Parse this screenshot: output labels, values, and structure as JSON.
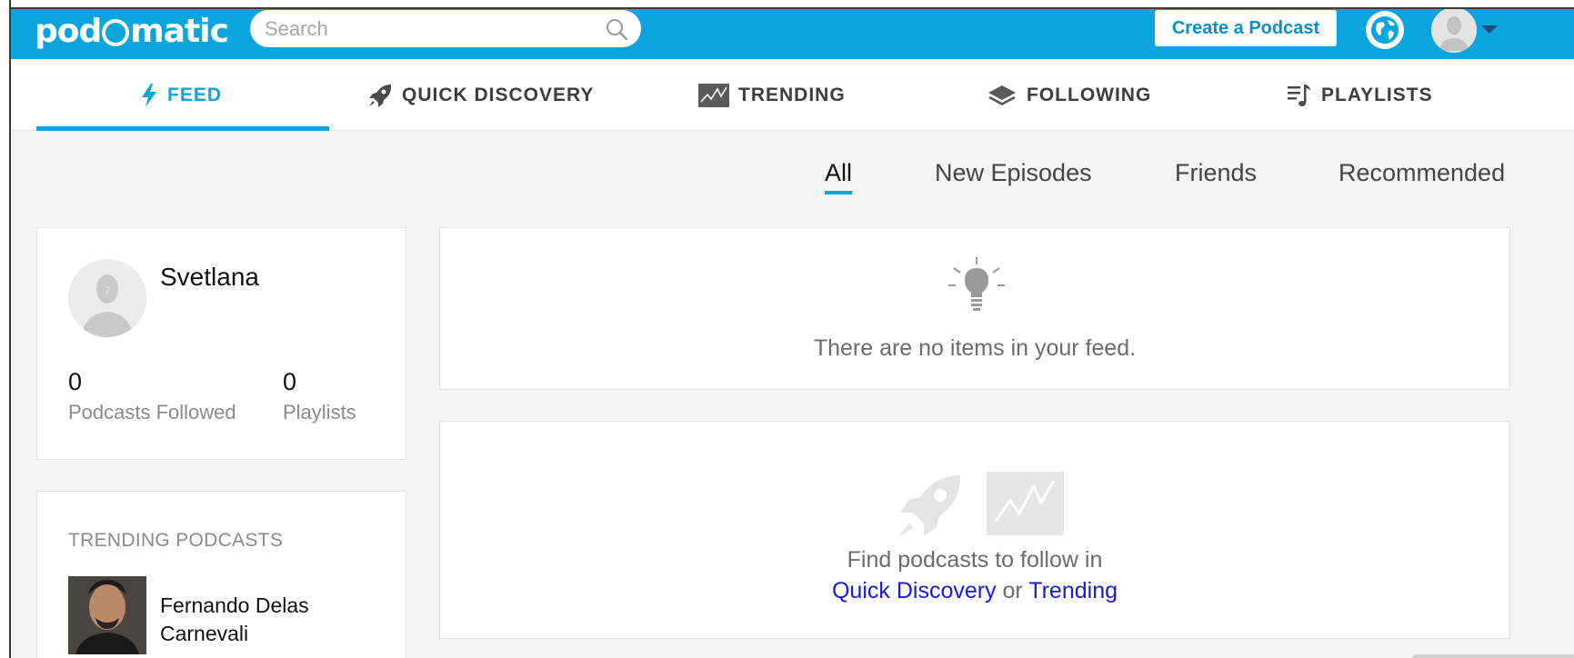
{
  "header": {
    "logo_text_left": "pod",
    "logo_text_right": "matic",
    "search_placeholder": "Search",
    "create_button": "Create a Podcast"
  },
  "nav": {
    "items": [
      {
        "label": "FEED",
        "icon": "lightning-icon",
        "active": true
      },
      {
        "label": "QUICK DISCOVERY",
        "icon": "rocket-icon",
        "active": false
      },
      {
        "label": "TRENDING",
        "icon": "trending-chart-icon",
        "active": false
      },
      {
        "label": "FOLLOWING",
        "icon": "layers-icon",
        "active": false
      },
      {
        "label": "PLAYLISTS",
        "icon": "playlist-icon",
        "active": false
      }
    ]
  },
  "filters": {
    "items": [
      "All",
      "New Episodes",
      "Friends",
      "Recommended"
    ],
    "active": "All"
  },
  "profile": {
    "name": "Svetlana",
    "podcasts_followed_count": "0",
    "podcasts_followed_label": "Podcasts Followed",
    "playlists_count": "0",
    "playlists_label": "Playlists"
  },
  "trending": {
    "title": "TRENDING PODCASTS",
    "items": [
      {
        "name": "Fernando Delas Carnevali"
      }
    ]
  },
  "feed": {
    "empty_message": "There are no items in your feed.",
    "find_prefix": "Find podcasts to follow in",
    "quick_discovery_link": "Quick Discovery",
    "or_text": "or",
    "trending_link": "Trending"
  },
  "colors": {
    "brand_blue": "#0aa4de",
    "link_blue": "#1a1ad8",
    "background": "#f4f4f4"
  }
}
